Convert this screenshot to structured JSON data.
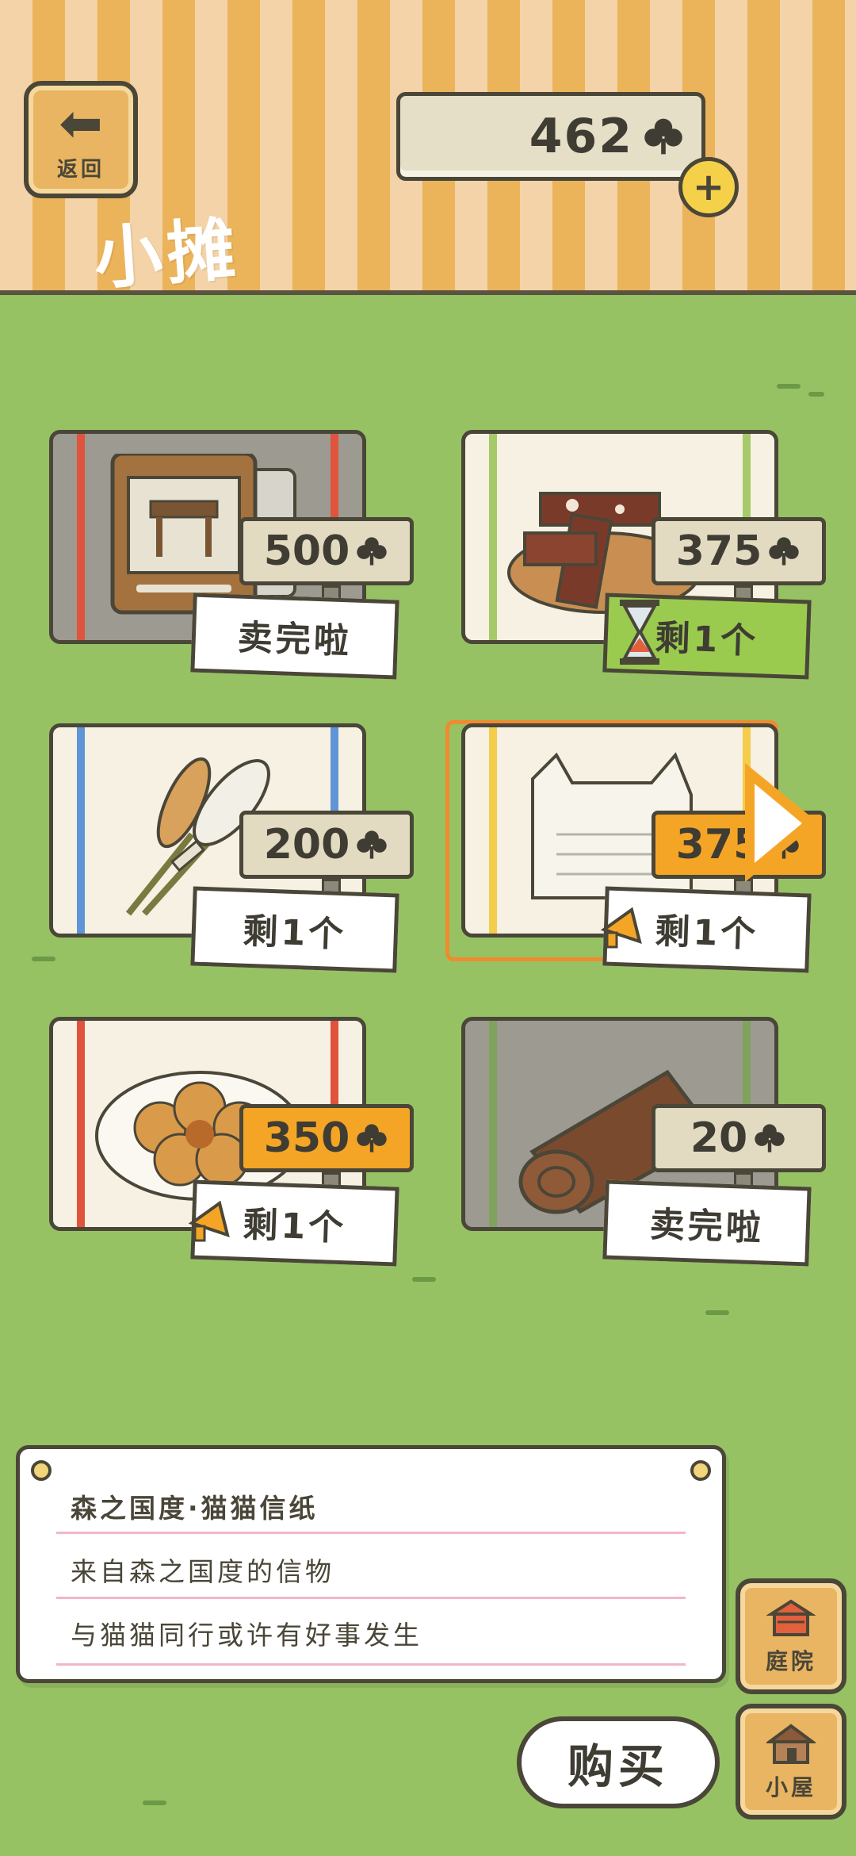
{
  "header": {
    "back_label": "返回",
    "title": "小摊",
    "currency_value": "462",
    "currency_icon": "clover-icon",
    "add_icon": "plus-icon"
  },
  "items": [
    {
      "name": "stool",
      "price": "500",
      "status": "卖完啦",
      "rug": "gray-red",
      "on_sale": false
    },
    {
      "name": "brownies",
      "price": "375",
      "status": "剩1个",
      "rug": "white-green",
      "on_sale": false,
      "timer": true
    },
    {
      "name": "wheat",
      "price": "200",
      "status": "剩1个",
      "rug": "white-blue",
      "on_sale": false
    },
    {
      "name": "cat-stationery",
      "price": "375",
      "status": "剩1个",
      "rug": "white-yellow",
      "on_sale": true,
      "selected": true
    },
    {
      "name": "donut",
      "price": "350",
      "status": "剩1个",
      "rug": "white-red",
      "on_sale": true
    },
    {
      "name": "log",
      "price": "20",
      "status": "卖完啦",
      "rug": "gray-green",
      "on_sale": false
    }
  ],
  "description": {
    "title": "森之国度·猫猫信纸",
    "line1": "来自森之国度的信物",
    "line2": "与猫猫同行或许有好事发生"
  },
  "buttons": {
    "yard": "庭院",
    "house": "小屋",
    "buy": "购买"
  },
  "colors": {
    "grass": "#96c264",
    "header_stripe_a": "#f3d3a7",
    "header_stripe_b": "#ebb35a",
    "sale": "#f5a526",
    "selected": "#f08a30"
  }
}
